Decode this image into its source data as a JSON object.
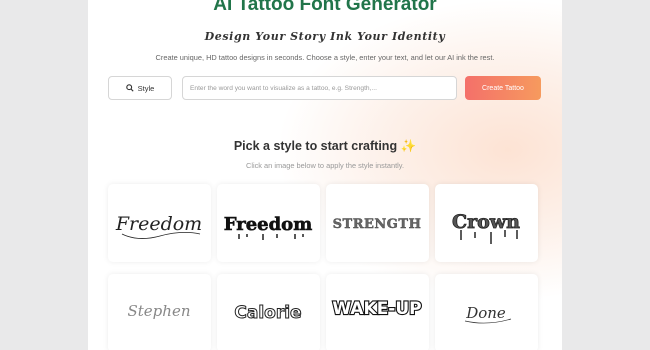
{
  "header": {
    "title": "AI Tattoo Font Generator",
    "tagline": "Design Your Story Ink Your Identity",
    "subtitle": "Create unique, HD tattoo designs in seconds. Choose a style, enter your text, and let our AI ink the rest."
  },
  "form": {
    "style_button_label": "Style",
    "input_placeholder": "Enter the word you want to visualize as a tattoo, e.g. Strength,...",
    "create_button_label": "Create Tattoo"
  },
  "styles_section": {
    "title": "Pick a style to start crafting",
    "title_emoji": "✨",
    "subtitle": "Click an image below to apply the style instantly.",
    "cards": [
      {
        "text": "Freedom",
        "style": "script"
      },
      {
        "text": "Freedom",
        "style": "blackletter-drip"
      },
      {
        "text": "STRENGTH",
        "style": "stone-serif"
      },
      {
        "text": "Crown",
        "style": "gothic-drip"
      },
      {
        "text": "Stephen",
        "style": "thin-script"
      },
      {
        "text": "Calorie",
        "style": "outline-rounded"
      },
      {
        "text": "WAKE-UP",
        "style": "graffiti"
      },
      {
        "text": "Done",
        "style": "signature"
      }
    ]
  },
  "colors": {
    "title_green": "#21754a",
    "button_gradient_start": "#f4706a",
    "button_gradient_end": "#f69a5e"
  },
  "icons": {
    "style_icon": "search-icon",
    "emoji_icon": "bee-sparkle-icon"
  }
}
